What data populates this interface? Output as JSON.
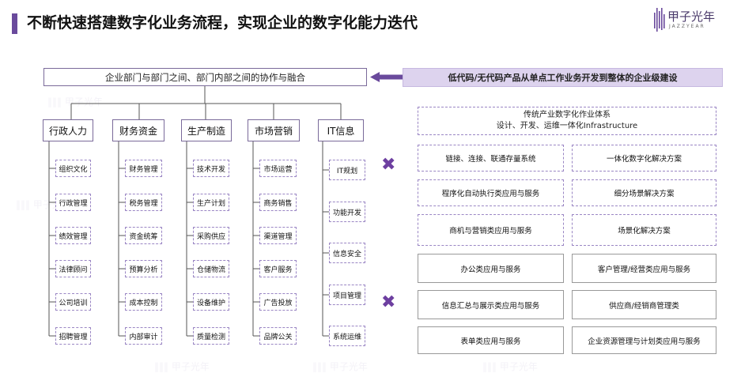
{
  "page_title": "不断快速搭建数字化业务流程，实现企业的数字化能力迭代",
  "logo": {
    "name_cn": "甲子光年",
    "name_en": "JAZZYEAR",
    "icon": "jazzyear-logo-icon"
  },
  "top_box": "企业部门与部门之间、部门内部之间的协作与融合",
  "banner": "低代码/无代码产品从单点工作业务开发到整体的企业级建设",
  "departments": [
    {
      "name": "行政人力",
      "items": [
        "组织文化",
        "行政管理",
        "绩效管理",
        "法律顾问",
        "公司培训",
        "招聘管理"
      ]
    },
    {
      "name": "财务资金",
      "items": [
        "财务管理",
        "税务管理",
        "资金统筹",
        "预算分析",
        "成本控制",
        "内部审计"
      ]
    },
    {
      "name": "生产制造",
      "items": [
        "技术开发",
        "生产计划",
        "采购供应",
        "仓储物流",
        "设备维护",
        "质量检测"
      ]
    },
    {
      "name": "市场营销",
      "items": [
        "市场运营",
        "商务销售",
        "渠道管理",
        "客户服务",
        "广告投放",
        "品牌公关"
      ]
    },
    {
      "name": "IT信息",
      "items": [
        "IT规划",
        "功能开发",
        "信息安全",
        "项目管理",
        "系统运维"
      ]
    }
  ],
  "traditional": {
    "line1": "传统产业数字化作业体系",
    "line2": "设计、开发、运维一体化Infrastructure"
  },
  "dashed_boxes": [
    "链接、连接、联通存量系统",
    "一体化数字化解决方案",
    "程序化自动执行类应用与服务",
    "细分场景解决方案",
    "商机与营销类应用与服务",
    "场景化解决方案"
  ],
  "solid_boxes": [
    "办公类应用与服务",
    "客户管理/经营类应用与服务",
    "信息汇总与展示类应用与服务",
    "供应商/经销商管理类",
    "表单类应用与服务",
    "企业资源管理与计划类应用与服务"
  ],
  "icons": {
    "cross": "cross-icon",
    "arrow": "arrow-left-icon"
  },
  "colors": {
    "accent": "#6a4a9c",
    "banner_bg": "#ddd3ee",
    "cross": "#6d3fa0"
  }
}
